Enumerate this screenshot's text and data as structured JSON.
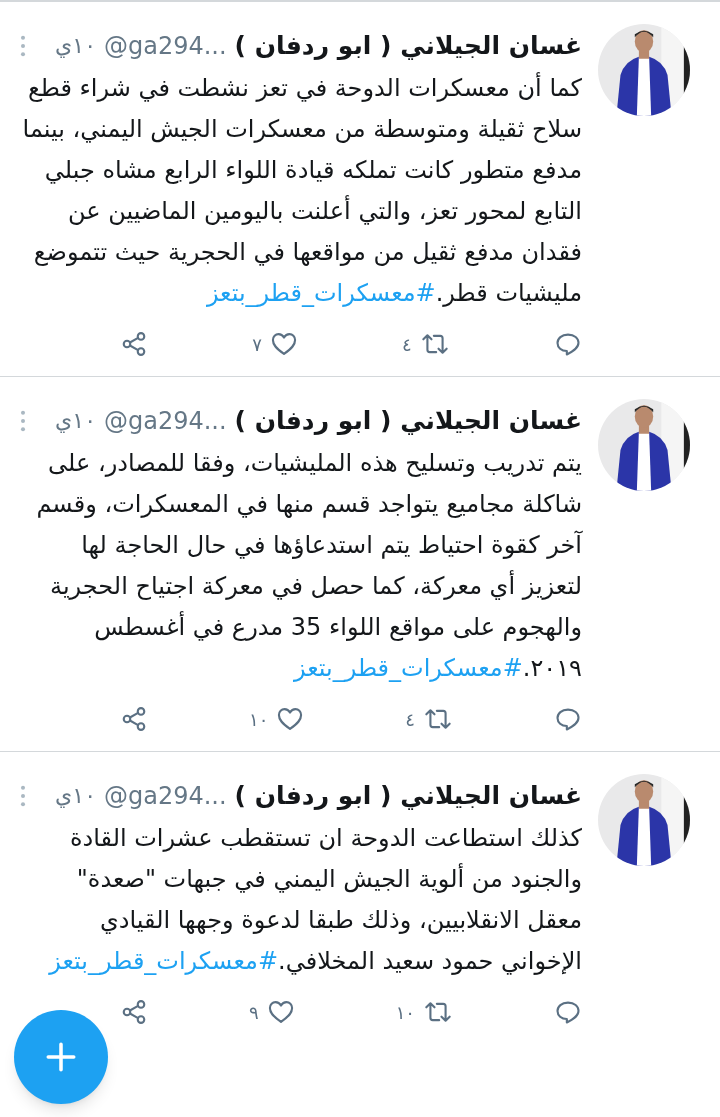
{
  "tweets": [
    {
      "name": "غسان الجيلاني ( ابو ردفان )",
      "handle": "@ga294...",
      "time": "١٠ي",
      "text": "كما أن معسكرات الدوحة في تعز نشطت في شراء قطع سلاح ثقيلة ومتوسطة من معسكرات الجيش اليمني، بينما مدفع متطور كانت تملكه قيادة اللواء الرابع مشاه جبلي التابع لمحور تعز، والتي أعلنت باليومين الماضيين عن فقدان مدفع ثقيل من مواقعها في الحجرية حيث تتموضع مليشيات قطر.",
      "hashtag": "#معسكرات_قطر_بتعز",
      "retweets": "٤",
      "likes": "٧"
    },
    {
      "name": "غسان الجيلاني ( ابو ردفان )",
      "handle": "@ga294...",
      "time": "١٠ي",
      "text": "يتم تدريب وتسليح هذه المليشيات، وفقا للمصادر، على شاكلة مجاميع يتواجد قسم منها في المعسكرات، وقسم آخر كقوة احتياط يتم استدعاؤها في حال الحاجة لها لتعزيز أي معركة، كما حصل في معركة اجتياح الحجرية والهجوم على مواقع اللواء 35 مدرع في أغسطس ٢٠١٩.",
      "hashtag": "#معسكرات_قطر_بتعز",
      "retweets": "٤",
      "likes": "١٠"
    },
    {
      "name": "غسان الجيلاني ( ابو ردفان )",
      "handle": "@ga294...",
      "time": "١٠ي",
      "text": "كذلك استطاعت الدوحة ان تستقطب عشرات القادة والجنود من ألوية الجيش اليمني في جبهات \"صعدة\" معقل الانقلابيين، وذلك طبقا لدعوة وجهها القيادي الإخواني حمود سعيد المخلافي.",
      "hashtag": "#معسكرات_قطر_بتعز",
      "retweets": "١٠",
      "likes": "٩"
    }
  ]
}
